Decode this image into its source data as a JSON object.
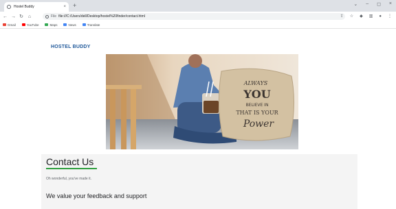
{
  "browser": {
    "tab_title": "Hostel Buddy",
    "tab_close": "×",
    "new_tab": "+",
    "url_scheme": "File",
    "url": "file:///C:/Users/dell/Desktop/hostel%20finder/contact.html",
    "window_controls": [
      "⌄",
      "–",
      "◻",
      "×"
    ],
    "bookmarks": [
      {
        "label": "Gmail",
        "color": "#ea4335"
      },
      {
        "label": "YouTube",
        "color": "#ff0000"
      },
      {
        "label": "Maps",
        "color": "#34a853"
      },
      {
        "label": "News",
        "color": "#4285f4"
      },
      {
        "label": "Translate",
        "color": "#4285f4"
      }
    ]
  },
  "site": {
    "logo": "HOSTEL BUDDY"
  },
  "contact": {
    "title": "Contact Us",
    "subtitle": "Oh wonderful, you've made it.",
    "feedback_heading": "We value your feedback and support"
  },
  "hero_pillow_text": [
    "ALWAYS",
    "YOU",
    "BELIEVE IN",
    "THAT IS YOUR",
    "Power"
  ],
  "colors": {
    "logo": "#1e5799",
    "underline": "#2e9e3e"
  }
}
